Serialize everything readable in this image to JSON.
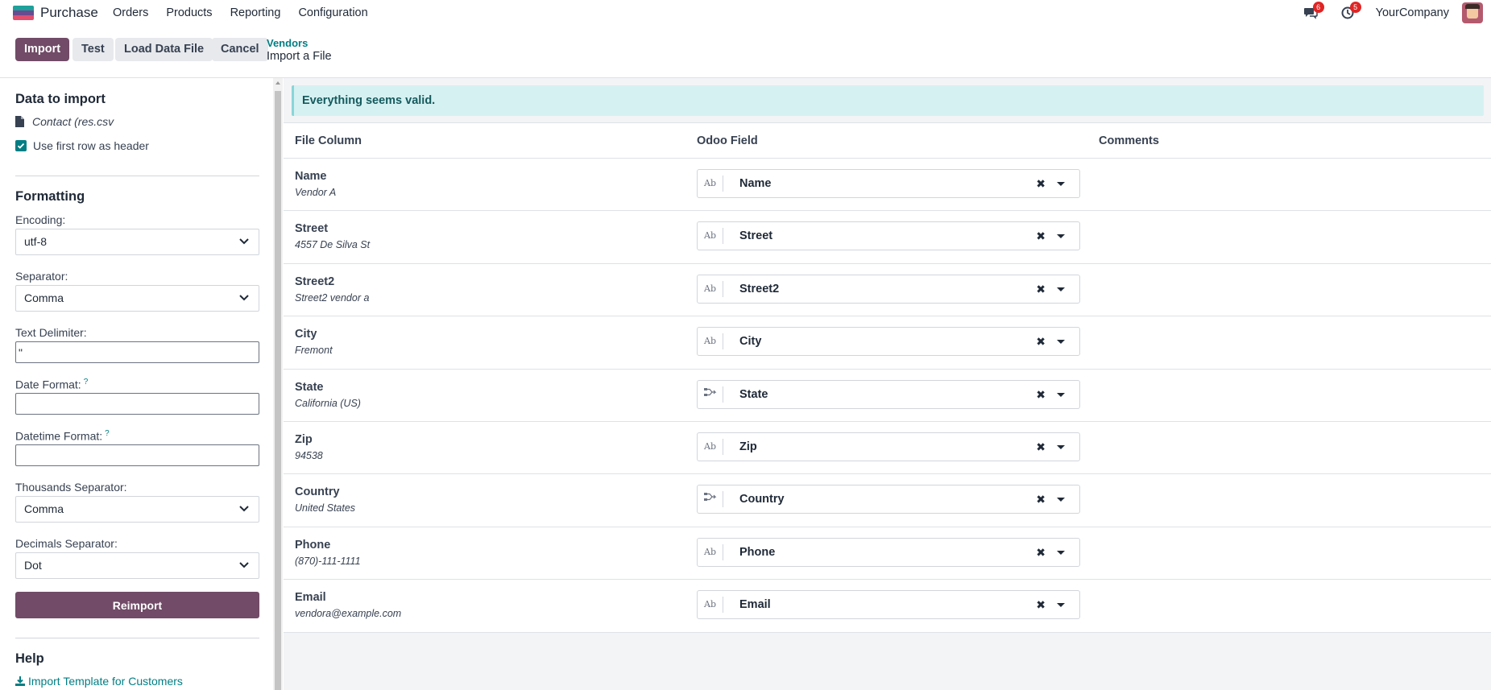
{
  "navbar": {
    "app_name": "Purchase",
    "menu": [
      "Orders",
      "Products",
      "Reporting",
      "Configuration"
    ],
    "messages_badge": "6",
    "activities_badge": "5",
    "company": "YourCompany"
  },
  "toolbar": {
    "import_label": "Import",
    "test_label": "Test",
    "load_label": "Load Data File",
    "cancel_label": "Cancel"
  },
  "breadcrumb": {
    "parent": "Vendors",
    "current": "Import a File"
  },
  "sidebar": {
    "data_title": "Data to import",
    "file_name": "Contact (res.csv",
    "header_checkbox_label": "Use first row as header",
    "header_checked": true,
    "formatting_title": "Formatting",
    "encoding_label": "Encoding:",
    "encoding_value": "utf-8",
    "separator_label": "Separator:",
    "separator_value": "Comma",
    "text_delimiter_label": "Text Delimiter:",
    "text_delimiter_value": "\"",
    "date_format_label": "Date Format:",
    "date_format_value": "",
    "datetime_format_label": "Datetime Format:",
    "datetime_format_value": "",
    "help_mark": "?",
    "thousands_label": "Thousands Separator:",
    "thousands_value": "Comma",
    "decimals_label": "Decimals Separator:",
    "decimals_value": "Dot",
    "reimport_label": "Reimport",
    "help_title": "Help",
    "help_link": "Import Template for Customers"
  },
  "main": {
    "alert": "Everything seems valid.",
    "columns": [
      "File Column",
      "Odoo Field",
      "Comments"
    ],
    "rows": [
      {
        "column": "Name",
        "sample": "Vendor A",
        "field": "Name",
        "type": "Ab"
      },
      {
        "column": "Street",
        "sample": "4557 De Silva St",
        "field": "Street",
        "type": "Ab"
      },
      {
        "column": "Street2",
        "sample": "Street2 vendor a",
        "field": "Street2",
        "type": "Ab"
      },
      {
        "column": "City",
        "sample": "Fremont",
        "field": "City",
        "type": "Ab"
      },
      {
        "column": "State",
        "sample": "California (US)",
        "field": "State",
        "type": "relation"
      },
      {
        "column": "Zip",
        "sample": "94538",
        "field": "Zip",
        "type": "Ab"
      },
      {
        "column": "Country",
        "sample": "United States",
        "field": "Country",
        "type": "relation"
      },
      {
        "column": "Phone",
        "sample": "(870)-111-1111",
        "field": "Phone",
        "type": "Ab"
      },
      {
        "column": "Email",
        "sample": "vendora@example.com",
        "field": "Email",
        "type": "Ab"
      }
    ]
  }
}
